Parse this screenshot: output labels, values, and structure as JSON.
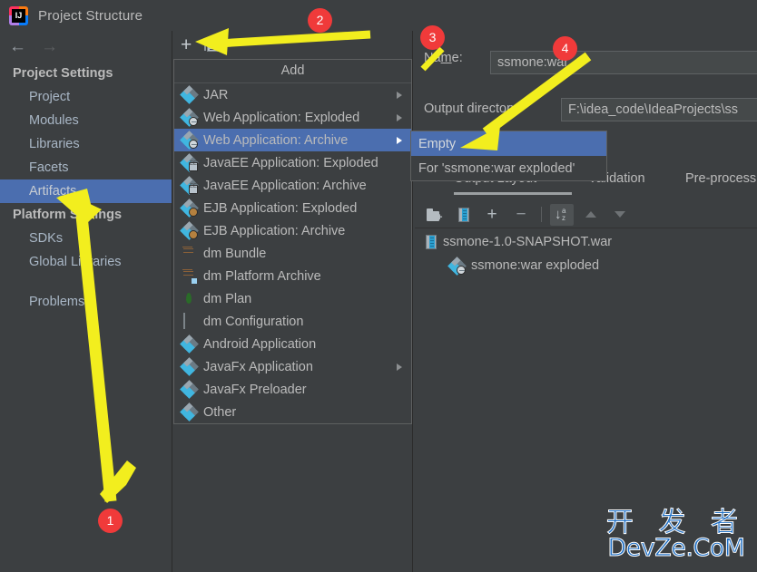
{
  "window": {
    "title": "Project Structure",
    "app_icon": "intellij-idea-icon"
  },
  "nav": {
    "back_icon": "arrow-left-icon",
    "forward_icon": "arrow-right-icon"
  },
  "sidebar": {
    "groups": [
      {
        "title": "Project Settings",
        "items": [
          {
            "label": "Project",
            "selected": false
          },
          {
            "label": "Modules",
            "selected": false
          },
          {
            "label": "Libraries",
            "selected": false
          },
          {
            "label": "Facets",
            "selected": false
          },
          {
            "label": "Artifacts",
            "selected": true
          }
        ]
      },
      {
        "title": "Platform Settings",
        "items": [
          {
            "label": "SDKs",
            "selected": false
          },
          {
            "label": "Global Libraries",
            "selected": false
          }
        ]
      }
    ],
    "problems": "Problems"
  },
  "mid_toolbar": {
    "add_label": "+",
    "add_icon": "plus-icon",
    "list_icon": "list-icon"
  },
  "add_menu": {
    "header": "Add",
    "items": [
      {
        "label": "JAR",
        "icon": "artifact-icon",
        "submenu": true,
        "selected": false
      },
      {
        "label": "Web Application: Exploded",
        "icon": "web-artifact-icon",
        "submenu": true,
        "selected": false
      },
      {
        "label": "Web Application: Archive",
        "icon": "web-artifact-icon",
        "submenu": true,
        "selected": true
      },
      {
        "label": "JavaEE Application: Exploded",
        "icon": "javaee-artifact-icon",
        "submenu": false,
        "selected": false
      },
      {
        "label": "JavaEE Application: Archive",
        "icon": "javaee-artifact-icon",
        "submenu": false,
        "selected": false
      },
      {
        "label": "EJB Application: Exploded",
        "icon": "ejb-artifact-icon",
        "submenu": false,
        "selected": false
      },
      {
        "label": "EJB Application: Archive",
        "icon": "ejb-artifact-icon",
        "submenu": false,
        "selected": false
      },
      {
        "label": "dm Bundle",
        "icon": "dm-bundle-icon",
        "submenu": false,
        "selected": false
      },
      {
        "label": "dm Platform Archive",
        "icon": "dm-platform-icon",
        "submenu": false,
        "selected": false
      },
      {
        "label": "dm Plan",
        "icon": "dm-plan-icon",
        "submenu": false,
        "selected": false
      },
      {
        "label": "dm Configuration",
        "icon": "dm-config-icon",
        "submenu": false,
        "selected": false
      },
      {
        "label": "Android Application",
        "icon": "artifact-icon",
        "submenu": false,
        "selected": false
      },
      {
        "label": "JavaFx Application",
        "icon": "artifact-icon",
        "submenu": true,
        "selected": false
      },
      {
        "label": "JavaFx Preloader",
        "icon": "artifact-icon",
        "submenu": false,
        "selected": false
      },
      {
        "label": "Other",
        "icon": "artifact-icon",
        "submenu": false,
        "selected": false
      }
    ]
  },
  "submenu": {
    "items": [
      {
        "label": "Empty",
        "selected": true
      },
      {
        "label": "For 'ssmone:war exploded'",
        "selected": false
      }
    ]
  },
  "details": {
    "name_label": "Name:",
    "name_value": "ssmone:war",
    "output_dir_label": "Output directory:",
    "output_dir_value": "F:\\idea_code\\IdeaProjects\\ss"
  },
  "tabs": [
    {
      "label": "Output Layout",
      "active": true
    },
    {
      "label": "Validation",
      "active": false
    },
    {
      "label": "Pre-processing",
      "active": false
    }
  ],
  "layout_toolbar": {
    "buttons": [
      {
        "icon": "add-directory-icon",
        "active": false
      },
      {
        "icon": "add-archive-icon",
        "active": false
      },
      {
        "icon": "add-copy-icon",
        "active": false
      },
      {
        "icon": "remove-icon",
        "active": false
      },
      {
        "icon": "sort-alphabetically-icon",
        "active": true
      },
      {
        "icon": "move-up-icon",
        "active": false
      },
      {
        "icon": "move-down-icon",
        "active": false
      }
    ]
  },
  "output_tree": [
    {
      "label": "ssmone-1.0-SNAPSHOT.war",
      "icon": "war-archive-icon",
      "level": 1
    },
    {
      "label": "ssmone:war exploded",
      "icon": "web-artifact-icon",
      "level": 2
    }
  ],
  "annotations": {
    "badges": [
      {
        "number": "1",
        "target": "sidebar-item-artifacts"
      },
      {
        "number": "2",
        "target": "add-artifact-button"
      },
      {
        "number": "3",
        "target": "name-label"
      },
      {
        "number": "4",
        "target": "submenu-item-empty"
      }
    ],
    "arrow_color": "#f2ee1e",
    "badge_color": "#f03a3a"
  },
  "watermark": {
    "line1": "开 发 者",
    "line2": "DevZe.CoM",
    "color": "#1f6fc4"
  }
}
